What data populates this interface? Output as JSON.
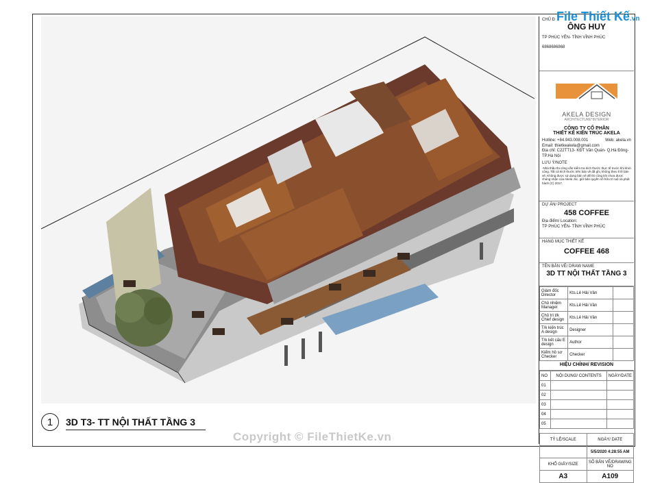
{
  "brand": {
    "text": "File Thiết Kế",
    "suffix": ".vn"
  },
  "drawing": {
    "caption_number": "1",
    "caption_title": "3D T3- TT NỘI THẤT TẦNG 3"
  },
  "watermark": "Copyright © FileThietKe.vn",
  "titleblock": {
    "client_label": "CHỦ Đ",
    "client_name": "ÔNG HUY",
    "client_address": "TP PHÚC YÊN- TỈNH VĨNH PHÚC",
    "client_phone": "6868686868",
    "logo_text": "AKELA DESIGN",
    "logo_sub": "ARCHITECTURE*INTERIOR",
    "company_line1": "CÔNG TY CỔ PHẦN",
    "company_line2": "THIẾT KẾ KIẾN TRÚC AKELA",
    "hotline": "Hotline: +84.943.008.001",
    "web": "Web: akela.vn",
    "email": "Email: thietkeakela@gmail.com",
    "address": "Địa chỉ: C22TT13- KĐT Văn Quán- Q.Hà Đông- TP.Hà Nội",
    "note_label": "LƯU Ý/NOTE",
    "note_text": "-Nhà thầu thi công cần kiểm tra kích thước thực tế trước khi khởi công. Tất cả kích thước trên bản vẽ đã ghi, không theo tỉ lệ bản vẽ. Không được sử dụng bản vẽ để thi công khi chưa được chúng nhận của Akela Jsc. giữ bản quyền số hữu trí tuệ và phát hành (C) 2017.",
    "project_label": "DỰ ÁN/ PROJECT",
    "project_name": "458 COFFEE",
    "location_label": "Địa điểm/ Location:",
    "location": "TP PHÚC YÊN- TỈNH VĨNH PHÚC",
    "category_label": "HẠNG MỤC THIẾT KẾ",
    "category": "COFFEE 468",
    "drawname_label": "TÊN BẢN VẼ/ DRAW NAME",
    "drawname": "3D TT NỘI THẤT TẦNG 3",
    "roles": [
      {
        "role": "Giám đốc Director",
        "name": "Kts.Lê Hải Vân"
      },
      {
        "role": "Chủ nhiệm Manager",
        "name": "Kts.Lê Hải Vân"
      },
      {
        "role": "Chủ trì t/k Chief design",
        "name": "Kts.Lê Hải Vân"
      },
      {
        "role": "T/k kiến trúc A design",
        "name": "Designer"
      },
      {
        "role": "T/k kết cấu E design",
        "name": "Author"
      },
      {
        "role": "Kiểm hồ sơ Checker",
        "name": "Checker"
      }
    ],
    "revision_title": "HIỆU CHỈNH/ REVISION",
    "rev_headers": [
      "NO",
      "NỘI DUNG/ CONTENTS",
      "NGÀY/DATE"
    ],
    "rev_rows": [
      "01",
      "02",
      "03",
      "04",
      "05"
    ],
    "scale_label": "TỶ LỆ/SCALE",
    "date_label": "NGÀY/ DATE",
    "date": "5/5/2020 4:28:55 AM",
    "paper_label": "KHỔ GIẤY/SIZE",
    "drawing_no_label": "SỐ BẢN VẼ/DRAWING NO",
    "paper": "A3",
    "drawing_no": "A109"
  }
}
